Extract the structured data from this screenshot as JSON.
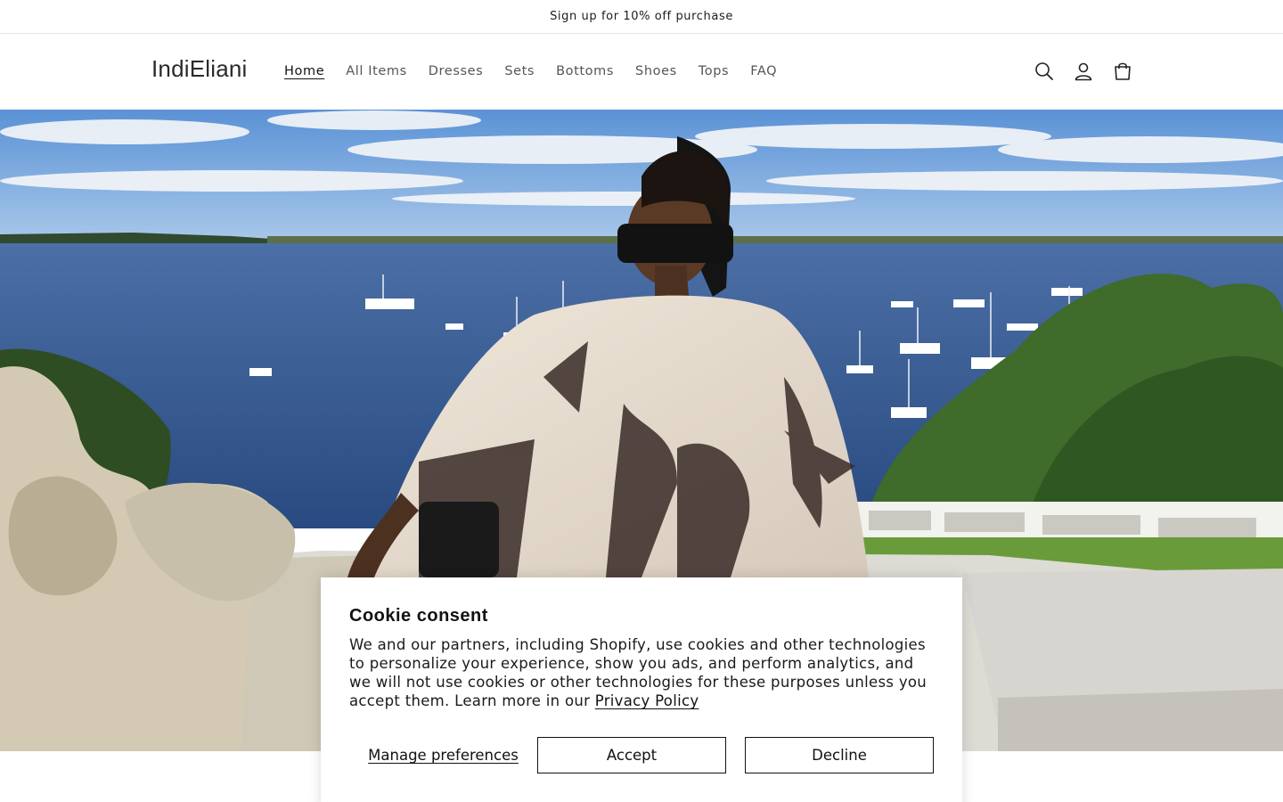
{
  "announcement": {
    "text": "Sign up for 10% off purchase"
  },
  "header": {
    "logo": "IndiEliani",
    "nav": [
      {
        "label": "Home",
        "active": true
      },
      {
        "label": "All Items"
      },
      {
        "label": "Dresses"
      },
      {
        "label": "Sets"
      },
      {
        "label": "Bottoms"
      },
      {
        "label": "Shoes"
      },
      {
        "label": "Tops"
      },
      {
        "label": "FAQ"
      }
    ],
    "icons": [
      "search-icon",
      "account-icon",
      "cart-icon"
    ]
  },
  "hero": {
    "image": "woman-in-palm-print-kaftan-overlooking-harbor"
  },
  "cookie": {
    "title": "Cookie consent",
    "body": "We and our partners, including Shopify, use cookies and other technologies to personalize your experience, show you ads, and perform analytics, and we will not use cookies or other technologies for these purposes unless you accept them. Learn more in our ",
    "link": "Privacy Policy",
    "manage_label": "Manage preferences",
    "accept_label": "Accept",
    "decline_label": "Decline"
  },
  "colors": {
    "text": "#121212",
    "nav": "#555555",
    "border": "#e6e6e6"
  }
}
